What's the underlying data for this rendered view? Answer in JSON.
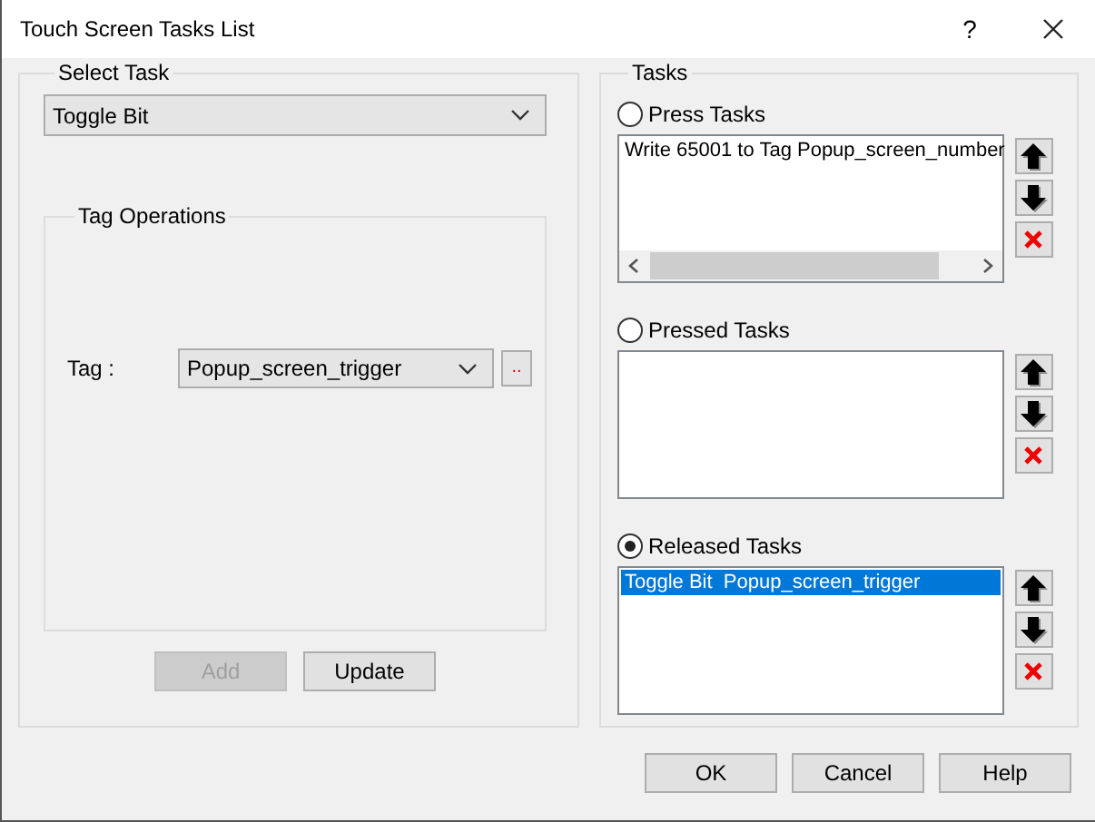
{
  "window": {
    "title": "Touch Screen Tasks List",
    "help_glyph": "?"
  },
  "select_task": {
    "label": "Select Task",
    "value": "Toggle Bit"
  },
  "tag_operations": {
    "label": "Tag Operations",
    "tag_label": "Tag :",
    "tag_value": "Popup_screen_trigger",
    "browse_button": ".."
  },
  "left_buttons": [
    {
      "label": "Add",
      "disabled": true
    },
    {
      "label": "Update",
      "disabled": false
    }
  ],
  "tasks": {
    "label": "Tasks",
    "groups": [
      {
        "label": "Press Tasks",
        "selected": false,
        "scrollbar": true,
        "items": [
          {
            "text": "Write 65001 to Tag Popup_screen_number",
            "selected": false
          }
        ]
      },
      {
        "label": "Pressed Tasks",
        "selected": false,
        "scrollbar": false
      },
      {
        "label": "Released Tasks",
        "selected": true,
        "scrollbar": false,
        "items": [
          {
            "text": "Toggle Bit  Popup_screen_trigger",
            "selected": true
          }
        ]
      }
    ]
  },
  "buttons": [
    {
      "label": "OK"
    },
    {
      "label": "Cancel"
    },
    {
      "label": "Help"
    }
  ]
}
